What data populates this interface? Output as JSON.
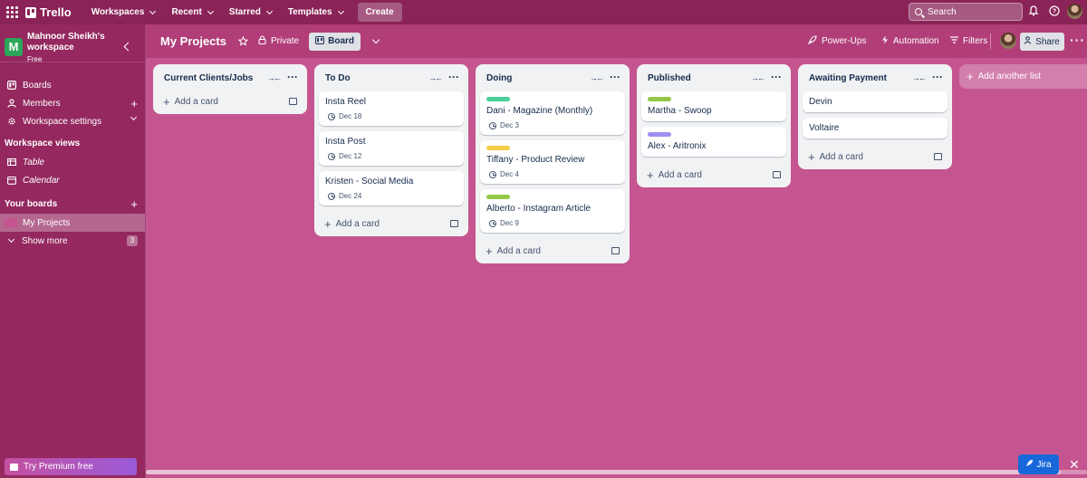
{
  "topnav": {
    "brand": "Trello",
    "items": [
      "Workspaces",
      "Recent",
      "Starred",
      "Templates"
    ],
    "create_label": "Create",
    "search_placeholder": "Search"
  },
  "sidebar": {
    "workspace_initial": "M",
    "workspace_name_line1": "Mahnoor Sheikh's",
    "workspace_name_line2": "workspace",
    "plan": "Free",
    "items": [
      {
        "label": "Boards",
        "icon": "board-icon"
      },
      {
        "label": "Members",
        "icon": "person-icon"
      },
      {
        "label": "Workspace settings",
        "icon": "gear-icon"
      }
    ],
    "views_heading": "Workspace views",
    "views": [
      {
        "label": "Table",
        "icon": "table-icon"
      },
      {
        "label": "Calendar",
        "icon": "calendar-icon"
      }
    ],
    "your_boards_heading": "Your boards",
    "boards": [
      {
        "label": "My Projects"
      }
    ],
    "show_more_label": "Show more",
    "show_more_count": "3",
    "premium_label": "Try Premium free"
  },
  "board": {
    "title": "My Projects",
    "visibility": "Private",
    "view_label": "Board",
    "powerups_label": "Power-Ups",
    "automation_label": "Automation",
    "filters_label": "Filters",
    "share_label": "Share"
  },
  "lists": [
    {
      "title": "Current Clients/Jobs",
      "cards": [],
      "add_label": "Add a card"
    },
    {
      "title": "To Do",
      "cards": [
        {
          "title": "Insta Reel",
          "due": "Dec 18"
        },
        {
          "title": "Insta Post",
          "due": "Dec 12"
        },
        {
          "title": "Kristen - Social Media",
          "due": "Dec 24"
        }
      ],
      "add_label": "Add a card"
    },
    {
      "title": "Doing",
      "cards": [
        {
          "title": "Dani - Magazine (Monthly)",
          "due": "Dec 3",
          "label_color": "#4bce97"
        },
        {
          "title": "Tiffany - Product Review",
          "due": "Dec 4",
          "label_color": "#f5cd47"
        },
        {
          "title": "Alberto - Instagram Article",
          "due": "Dec 9",
          "label_color": "#94c748"
        }
      ],
      "add_label": "Add a card"
    },
    {
      "title": "Published",
      "cards": [
        {
          "title": "Martha - Swoop",
          "label_color": "#94c748"
        },
        {
          "title": "Alex - Aritronix",
          "label_color": "#9f8fef"
        }
      ],
      "add_label": "Add a card"
    },
    {
      "title": "Awaiting Payment",
      "cards": [
        {
          "title": "Devin"
        },
        {
          "title": "Voltaire"
        }
      ],
      "add_label": "Add a card"
    }
  ],
  "add_list_label": "Add another list",
  "jira_label": "Jira",
  "colors": {
    "board_bg": "#c55590",
    "topbar": "#8a2357",
    "sidebar": "#94285f",
    "workspace_logo": "#2da55a",
    "jira": "#1868db"
  }
}
